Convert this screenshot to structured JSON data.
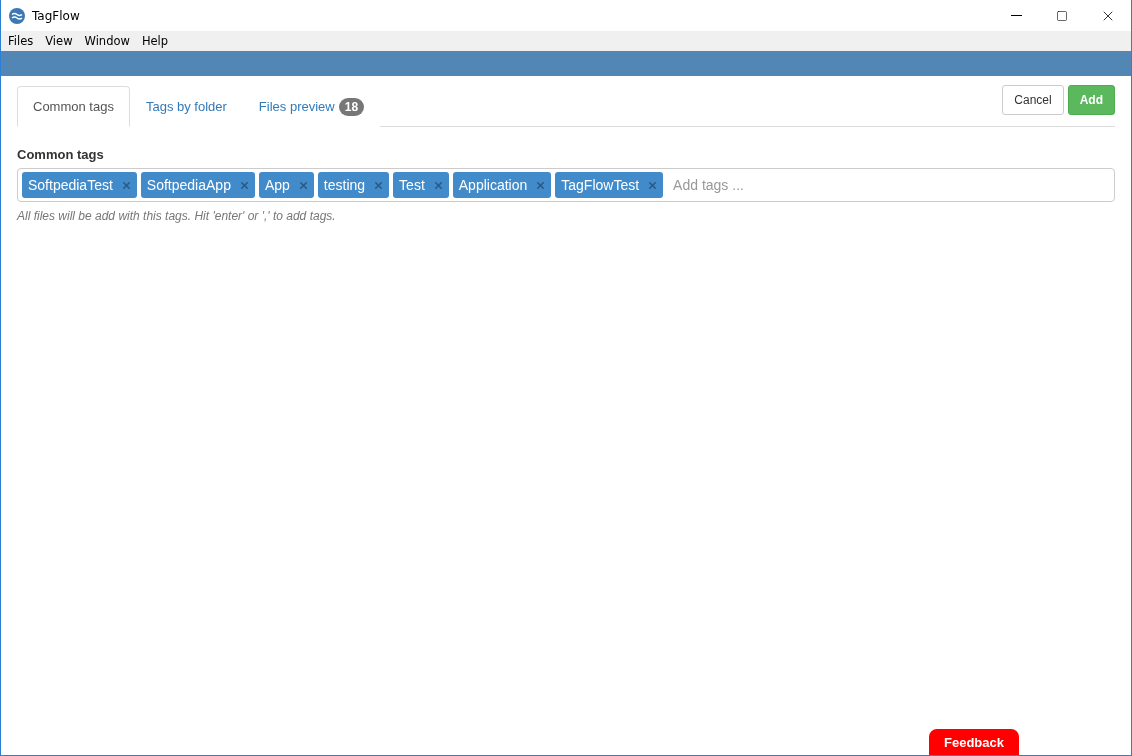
{
  "window": {
    "title": "TagFlow"
  },
  "menu": [
    "Files",
    "View",
    "Window",
    "Help"
  ],
  "tabs": [
    {
      "label": "Common tags",
      "selected": true
    },
    {
      "label": "Tags by folder",
      "selected": false
    },
    {
      "label": "Files preview",
      "selected": false,
      "badge": "18"
    }
  ],
  "actions": [
    {
      "label": "Cancel",
      "kind": "default"
    },
    {
      "label": "Add",
      "kind": "primary"
    }
  ],
  "section": {
    "title": "Common tags",
    "tags": [
      "SoftpediaTest",
      "SoftpediaApp",
      "App",
      "testing",
      "Test",
      "Application",
      "TagFlowTest"
    ],
    "placeholder": "Add tags ...",
    "hint": "All files will be add with this tags. Hit 'enter' or ',' to add tags."
  },
  "feedback": "Feedback"
}
